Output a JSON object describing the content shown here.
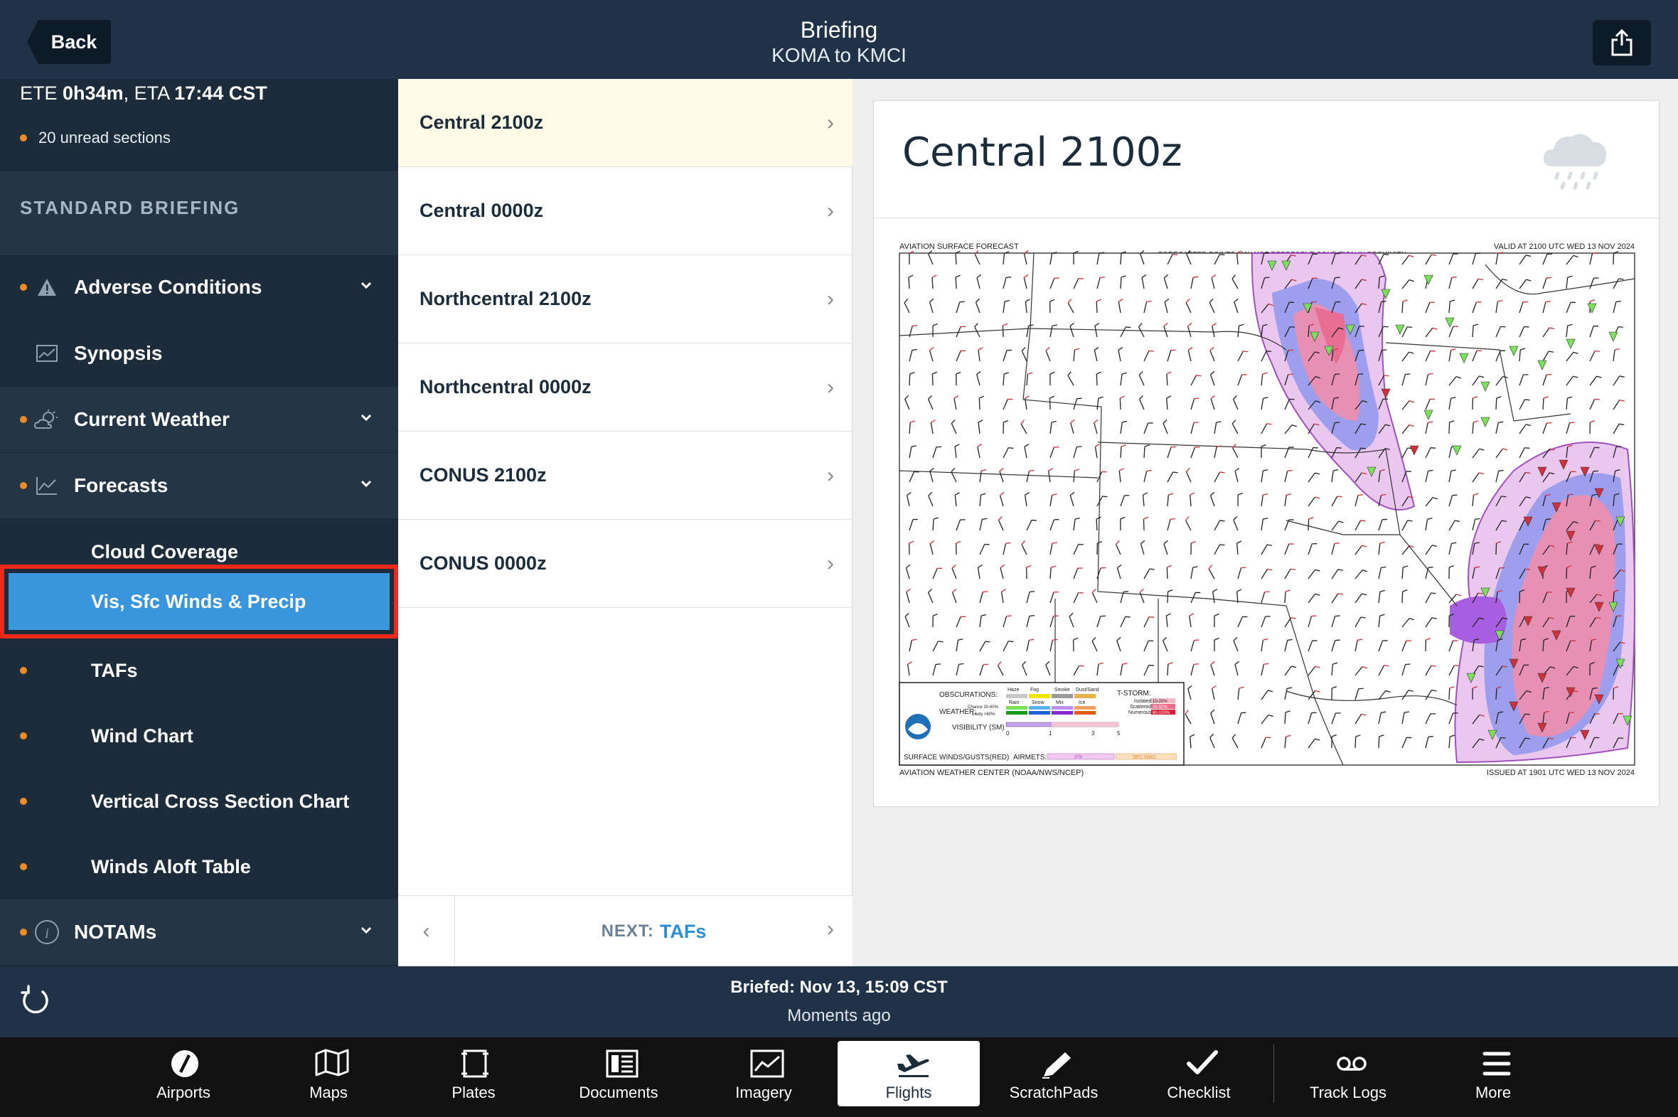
{
  "header": {
    "back_label": "Back",
    "title": "Briefing",
    "subtitle": "KOMA to KMCI"
  },
  "sidebar": {
    "ete_label": "ETE",
    "ete_value": "0h34m",
    "eta_label": "ETA",
    "eta_value": "17:44 CST",
    "unread": "20 unread sections",
    "section_title": "STANDARD BRIEFING",
    "items": [
      {
        "label": "Adverse Conditions",
        "icon": "warning-icon",
        "unread": true,
        "expandable": true
      },
      {
        "label": "Synopsis",
        "icon": "chart-icon",
        "unread": false,
        "expandable": false
      },
      {
        "label": "Current Weather",
        "icon": "partly-cloudy-icon",
        "unread": true,
        "expandable": true
      },
      {
        "label": "Forecasts",
        "icon": "trend-icon",
        "unread": true,
        "expandable": true
      },
      {
        "label": "Cloud Coverage",
        "sub": true
      },
      {
        "label": "Vis, Sfc Winds & Precip",
        "sub": true,
        "selected": true
      },
      {
        "label": "TAFs",
        "sub": true,
        "unread": true
      },
      {
        "label": "Wind Chart",
        "sub": true,
        "unread": true
      },
      {
        "label": "Vertical Cross Section Chart",
        "sub": true,
        "unread": true
      },
      {
        "label": "Winds Aloft Table",
        "sub": true,
        "unread": true
      },
      {
        "label": "NOTAMs",
        "icon": "info-icon",
        "unread": true,
        "expandable": true
      }
    ]
  },
  "list": {
    "items": [
      "Central 2100z",
      "Central 0000z",
      "Northcentral 2100z",
      "Northcentral 0000z",
      "CONUS 2100z",
      "CONUS 0000z"
    ],
    "next_label": "NEXT:",
    "next_value": "TAFs"
  },
  "content": {
    "title": "Central 2100z",
    "map": {
      "top_left": "AVIATION SURFACE FORECAST",
      "top_center": "FORECASTED POINTS MAY NOT REPRESENT CONDITION IN PROXIMITY",
      "top_right": "VALID AT 2100 UTC WED 13 NOV 2024",
      "bottom_left": "AVIATION WEATHER CENTER (NOAA/NWS/NCEP)",
      "bottom_right": "ISSUED AT 1901 UTC WED 13 NOV 2024",
      "legend": {
        "obscurations": "OBSCURATIONS:",
        "weather": "WEATHER:",
        "visibility": "VISIBILITY (SM)",
        "surface_winds": "SURFACE WINDS/GUSTS(RED)",
        "airmets": "AIRMETS:",
        "tstorm": "T-STORM:",
        "obs_types": [
          "Haze",
          "Fog",
          "Smoke",
          "Dust/Sand"
        ],
        "wx_types": [
          "Rain",
          "Snow",
          "Mix",
          "Ice"
        ],
        "chance": "Chance 30-60%",
        "likely": "Likely >60%",
        "ts_levels": [
          "Isolated",
          "Scattered",
          "Numerous"
        ],
        "ts_pct": [
          "10-20%",
          "30-50%",
          "60-100%"
        ],
        "vis_ticks": [
          "0",
          "1",
          "3",
          "5"
        ],
        "airmet_types": [
          "IFR",
          "SFC WND"
        ]
      }
    }
  },
  "status": {
    "briefed": "Briefed: Nov 13, 15:09 CST",
    "ago": "Moments ago"
  },
  "tabs": [
    {
      "label": "Airports",
      "icon": "airports-icon"
    },
    {
      "label": "Maps",
      "icon": "maps-icon"
    },
    {
      "label": "Plates",
      "icon": "plates-icon"
    },
    {
      "label": "Documents",
      "icon": "documents-icon"
    },
    {
      "label": "Imagery",
      "icon": "imagery-icon"
    },
    {
      "label": "Flights",
      "icon": "flights-icon",
      "active": true
    },
    {
      "label": "ScratchPads",
      "icon": "scratchpads-icon"
    },
    {
      "label": "Checklist",
      "icon": "checklist-icon"
    },
    {
      "label": "Track Logs",
      "icon": "track-logs-icon"
    },
    {
      "label": "More",
      "icon": "more-icon"
    }
  ],
  "colors": {
    "header_bg": "#1f3247",
    "sidebar_bg": "#1d2c3b",
    "selected_bg": "#3a96dc",
    "selected_outline": "#f02a1a",
    "unread_dot": "#f08a24",
    "next_accent": "#2c8fd6"
  }
}
